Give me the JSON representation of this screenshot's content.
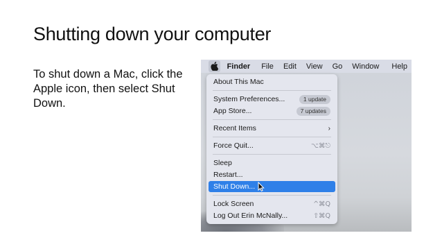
{
  "slide": {
    "title": "Shutting down your computer",
    "body": "To shut down a Mac, click the Apple icon, then select Shut Down."
  },
  "menubar": {
    "items": [
      "Finder",
      "File",
      "Edit",
      "View",
      "Go",
      "Window",
      "Help"
    ],
    "apple_icon": "apple-icon"
  },
  "apple_menu": {
    "about": "About This Mac",
    "system_prefs": "System Preferences...",
    "system_prefs_badge": "1 update",
    "app_store": "App Store...",
    "app_store_badge": "7 updates",
    "recent_items": "Recent Items",
    "force_quit": "Force Quit...",
    "force_quit_shortcut": "⌥⌘⎋",
    "sleep": "Sleep",
    "restart": "Restart...",
    "shut_down": "Shut Down...",
    "lock_screen": "Lock Screen",
    "lock_screen_shortcut": "^⌘Q",
    "log_out": "Log Out Erin McNally...",
    "log_out_shortcut": "⇧⌘Q"
  },
  "colors": {
    "selection": "#2f80e8",
    "menu_bg": "#e4e6ee"
  }
}
